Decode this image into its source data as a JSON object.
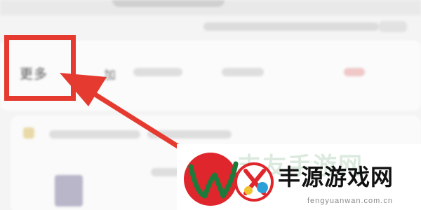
{
  "menu": {
    "more_label": "更多",
    "next_tab_label": "加"
  },
  "watermark": {
    "site_name": "丰源游戏网",
    "url": "fengyuanwan.com.cn"
  },
  "colors": {
    "highlight": "#e53a2f",
    "logo_red": "#e0262d",
    "logo_green": "#1e7a3a"
  },
  "icons": {
    "pointer": "arrow-icon",
    "logo": "site-logo-icon"
  }
}
